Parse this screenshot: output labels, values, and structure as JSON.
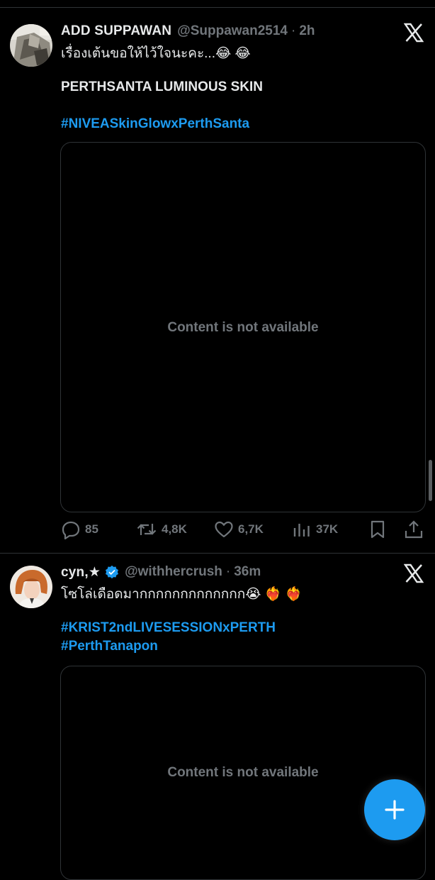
{
  "tweets": [
    {
      "display_name": "ADD  SUPPAWAN",
      "handle": "@Suppawan2514",
      "separator": "·",
      "time": "2h",
      "verified": false,
      "text_line": "เรื่องเต้นขอให้ไว้ใจนะคะ...😂 😂",
      "bold_line": "PERTHSANTA LUMINOUS SKIN",
      "hashtags": [
        "#NIVEASkinGlowxPerthSanta"
      ],
      "media_message": "Content is not available",
      "stats": {
        "replies": "85",
        "retweets": "4,8K",
        "likes": "6,7K",
        "views": "37K"
      }
    },
    {
      "display_name": "cyn,★",
      "handle": "@withhercrush",
      "separator": "·",
      "time": "36m",
      "verified": true,
      "text_line": "โซโล่เดือดมากกกกกกกกกกกกก😭 ❤️‍🔥 ❤️‍🔥",
      "hashtags": [
        "#KRIST2ndLIVESESSIONxPERTH",
        "#PerthTanapon"
      ],
      "media_message": "Content is not available"
    }
  ],
  "icons": {
    "close_logo": "x-logo-icon",
    "reply": "reply-icon",
    "retweet": "retweet-icon",
    "like": "heart-icon",
    "views": "views-icon",
    "bookmark": "bookmark-icon",
    "share": "share-icon",
    "compose": "plus-icon"
  },
  "colors": {
    "background": "#000000",
    "text": "#e7e9ea",
    "muted": "#71767b",
    "accent": "#1d9bf0",
    "border": "#2f3336"
  }
}
